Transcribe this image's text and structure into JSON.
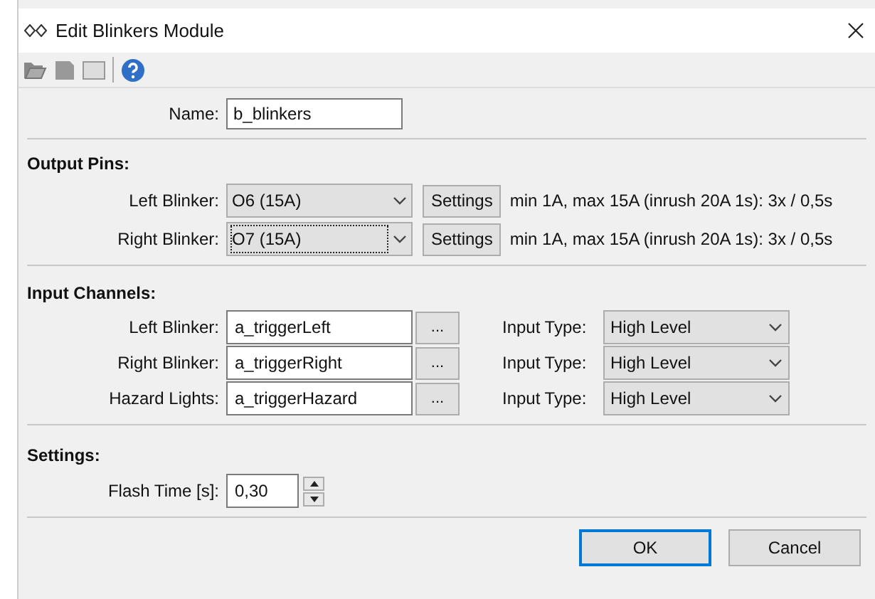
{
  "window": {
    "title": "Edit Blinkers Module"
  },
  "toolbar": [
    {
      "kind": "open"
    },
    {
      "kind": "save"
    },
    {
      "kind": "blank"
    },
    {
      "kind": "separator"
    },
    {
      "kind": "help"
    }
  ],
  "name_field": {
    "label": "Name:",
    "value": "b_blinkers"
  },
  "output_pins": {
    "title": "Output Pins:",
    "rows": [
      {
        "label": "Left Blinker:",
        "value": "O6 (15A)",
        "focused": false,
        "button": "Settings",
        "info": "min 1A, max 15A (inrush 20A 1s): 3x / 0,5s"
      },
      {
        "label": "Right Blinker:",
        "value": "O7 (15A)",
        "focused": true,
        "button": "Settings",
        "info": "min 1A, max 15A (inrush 20A 1s): 3x / 0,5s"
      }
    ]
  },
  "input_channels": {
    "title": "Input Channels:",
    "rows": [
      {
        "label": "Left Blinker:",
        "value": "a_triggerLeft",
        "button": "...",
        "type_label": "Input Type:",
        "type_value": "High Level"
      },
      {
        "label": "Right Blinker:",
        "value": "a_triggerRight",
        "button": "...",
        "type_label": "Input Type:",
        "type_value": "High Level"
      },
      {
        "label": "Hazard Lights:",
        "value": "a_triggerHazard",
        "button": "...",
        "type_label": "Input Type:",
        "type_value": "High Level"
      }
    ]
  },
  "settings": {
    "title": "Settings:",
    "label": "Flash Time [s]:",
    "value": "0,30"
  },
  "buttons": [
    {
      "label": "OK",
      "default": true
    },
    {
      "label": "Cancel",
      "default": false
    }
  ]
}
